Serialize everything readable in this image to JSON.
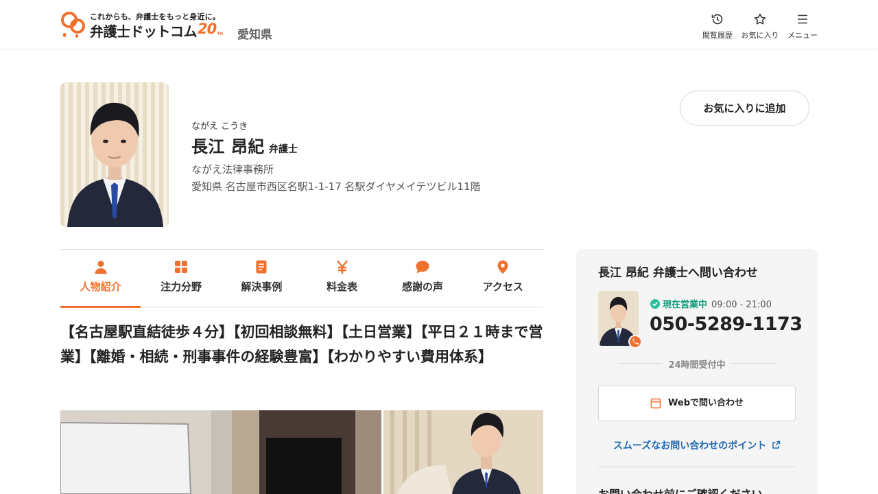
{
  "header": {
    "tagline": "これからも、弁護士をもっと身近に。",
    "brand": "弁護士ドットコム",
    "brand_20": "20",
    "brand_th": "TH",
    "prefecture": "愛知県",
    "nav": [
      {
        "label": "閲覧履歴",
        "icon": "history-icon"
      },
      {
        "label": "お気に入り",
        "icon": "star-icon"
      },
      {
        "label": "メニュー",
        "icon": "hamburger-icon"
      }
    ]
  },
  "profile": {
    "furigana": "ながえ こうき",
    "name": "長江 昂紀",
    "title_suffix": "弁護士",
    "firm": "ながえ法律事務所",
    "address": "愛知県 名古屋市西区名駅1-1-17 名駅ダイヤメイテツビル11階",
    "favorite_button": "お気に入りに追加"
  },
  "tabs": [
    {
      "label": "人物紹介",
      "icon": "person-icon",
      "active": true
    },
    {
      "label": "注力分野",
      "icon": "grid-icon",
      "active": false
    },
    {
      "label": "解決事例",
      "icon": "document-icon",
      "active": false
    },
    {
      "label": "料金表",
      "icon": "yen-icon",
      "active": false
    },
    {
      "label": "感謝の声",
      "icon": "speech-bubble-icon",
      "active": false
    },
    {
      "label": "アクセス",
      "icon": "map-pin-icon",
      "active": false
    }
  ],
  "headline": "【名古屋駅直結徒歩４分】【初回相談無料】【土日営業】【平日２１時まで営業】【離婚・相続・刑事事件の経験豊富】【わかりやすい費用体系】",
  "sidebar": {
    "title": "長江 昂紀 弁護士へ問い合わせ",
    "status": "現在営業中",
    "hours": "09:00 - 21:00",
    "phone": "050-5289-1173",
    "available": "24時間受付中",
    "web_button": "Webで問い合わせ",
    "tips_link": "スムーズなお問い合わせのポイント",
    "confirm_heading": "お問い合わせ前にご確認ください"
  },
  "colors": {
    "accent": "#f0702d",
    "open_status": "#0e9c79",
    "link": "#1d67b3"
  }
}
